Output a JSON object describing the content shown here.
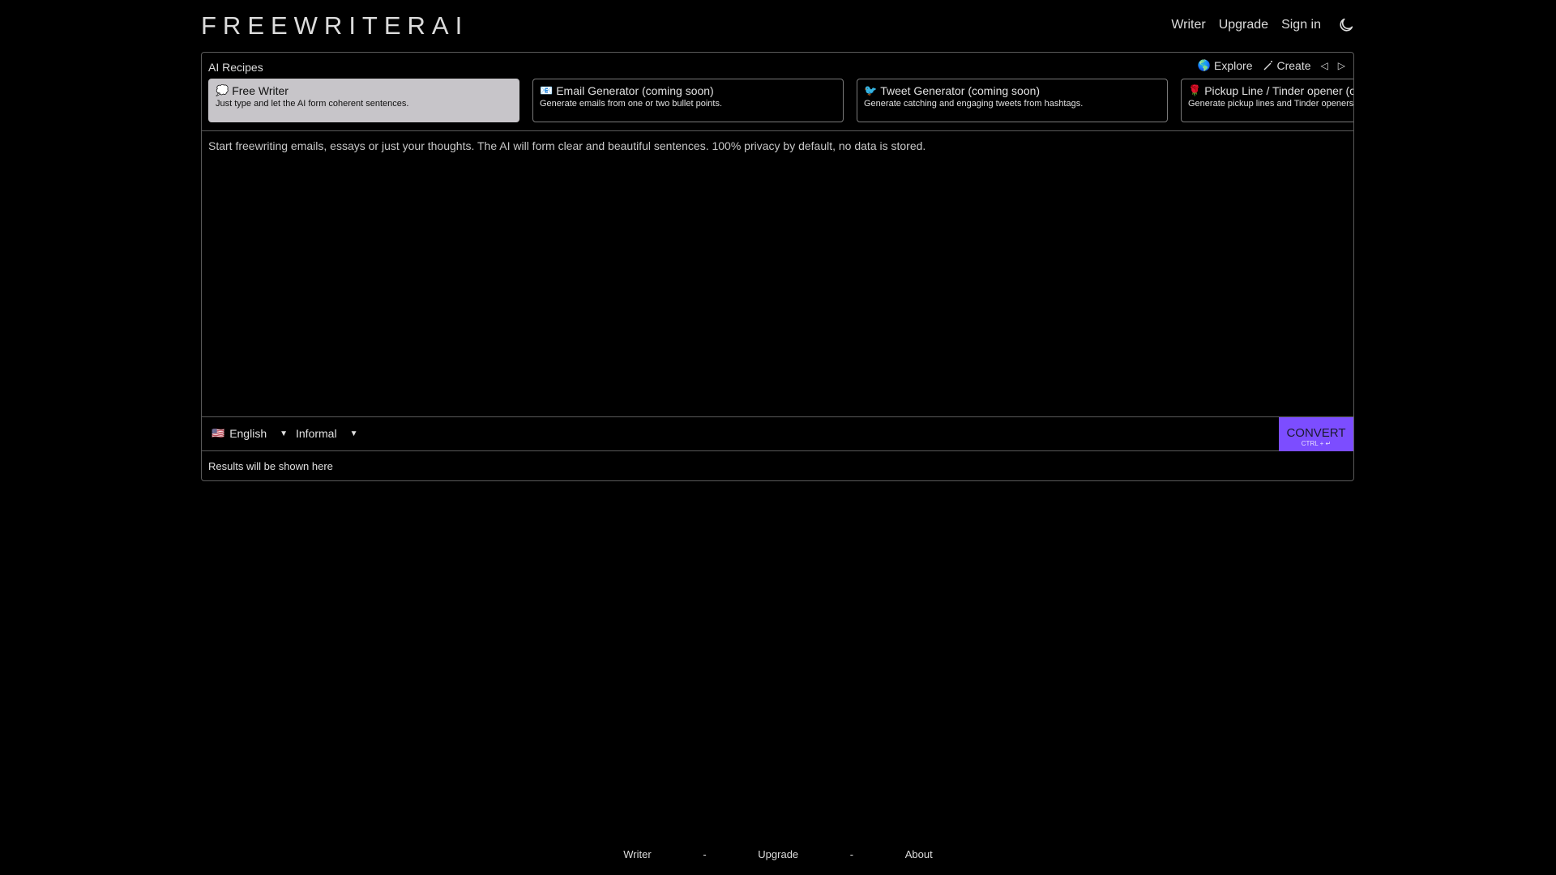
{
  "header": {
    "logo": "FREEWRITERAI",
    "nav": {
      "writer": "Writer",
      "upgrade": "Upgrade",
      "signin": "Sign in"
    }
  },
  "recipes": {
    "title": "AI Recipes",
    "actions": {
      "explore": "Explore",
      "create": "Create"
    },
    "cards": [
      {
        "emoji": "💭",
        "title": "Free Writer",
        "desc": "Just type and let the AI form coherent sentences."
      },
      {
        "emoji": "📧",
        "title": "Email Generator (coming soon)",
        "desc": "Generate emails from one or two bullet points."
      },
      {
        "emoji": "🐦",
        "title": "Tweet Generator (coming soon)",
        "desc": "Generate catching and engaging tweets from hashtags."
      },
      {
        "emoji": "🌹",
        "title": "Pickup Line / Tinder opener (coming soon)",
        "desc": "Generate pickup lines and Tinder openers."
      }
    ]
  },
  "editor": {
    "placeholder": "Start freewriting emails, essays or just your thoughts. The AI will form clear and beautiful sentences. 100% privacy by default, no data is stored."
  },
  "controls": {
    "language": {
      "flag": "🇺🇸",
      "value": "English"
    },
    "tone": "Informal",
    "convert": {
      "label": "CONVERT",
      "shortcut": "CTRL + ↵"
    }
  },
  "results": "Results will be shown here",
  "footer": {
    "writer": "Writer",
    "upgrade": "Upgrade",
    "about": "About",
    "sep": "-"
  },
  "colors": {
    "accent": "#7c4dff",
    "background": "#000000",
    "active_card": "#c7c5c9"
  }
}
